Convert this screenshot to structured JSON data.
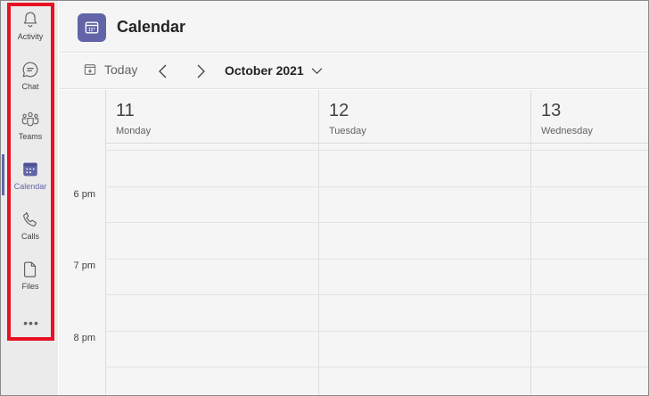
{
  "rail": {
    "items": [
      {
        "label": "Activity",
        "icon": "bell-icon"
      },
      {
        "label": "Chat",
        "icon": "chat-icon"
      },
      {
        "label": "Teams",
        "icon": "teams-icon"
      },
      {
        "label": "Calendar",
        "icon": "calendar-icon",
        "active": true
      },
      {
        "label": "Calls",
        "icon": "phone-icon"
      },
      {
        "label": "Files",
        "icon": "file-icon"
      }
    ],
    "more": "•••"
  },
  "header": {
    "title": "Calendar",
    "icon": "calendar-app-icon"
  },
  "toolbar": {
    "today_label": "Today",
    "month_label": "October 2021"
  },
  "calendar": {
    "days": [
      {
        "num": "11",
        "name": "Monday"
      },
      {
        "num": "12",
        "name": "Tuesday"
      },
      {
        "num": "13",
        "name": "Wednesday"
      }
    ],
    "times": [
      "6 pm",
      "7 pm",
      "8 pm"
    ]
  },
  "colors": {
    "accent": "#6264a7",
    "rail_bg": "#ebebeb",
    "content_bg": "#f5f5f5",
    "highlight": "#e81123"
  }
}
